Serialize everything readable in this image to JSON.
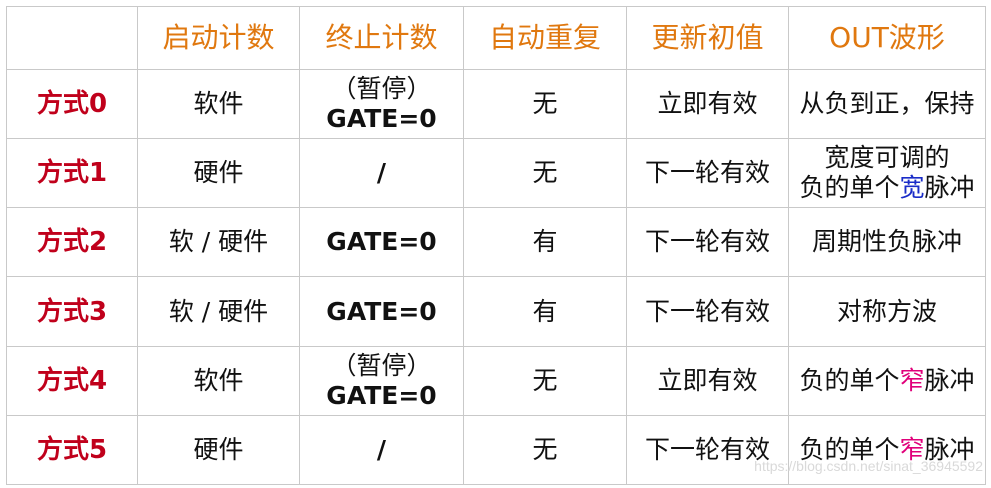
{
  "headers": [
    "",
    "启动计数",
    "终止计数",
    "自动重复",
    "更新初值",
    "OUT波形"
  ],
  "rows": [
    {
      "mode": "方式0",
      "start": "软件",
      "stop_top": "（暂停）",
      "stop_bottom": "GATE=0",
      "repeat": "无",
      "update": "立即有效",
      "out_pre": "从负到正，保持",
      "out_hl": "",
      "out_post": ""
    },
    {
      "mode": "方式1",
      "start": "硬件",
      "stop_top": "",
      "stop_bottom": "/",
      "repeat": "无",
      "update": "下一轮有效",
      "out_line1": "宽度可调的",
      "out_pre": "负的单个",
      "out_hl": "宽",
      "out_post": "脉冲",
      "out_hl_color": "#1a2cc8"
    },
    {
      "mode": "方式2",
      "start": "软 / 硬件",
      "stop_top": "",
      "stop_bottom": "GATE=0",
      "repeat": "有",
      "update": "下一轮有效",
      "out_pre": "周期性负脉冲",
      "out_hl": "",
      "out_post": ""
    },
    {
      "mode": "方式3",
      "start": "软 / 硬件",
      "stop_top": "",
      "stop_bottom": "GATE=0",
      "repeat": "有",
      "update": "下一轮有效",
      "out_pre": "对称方波",
      "out_hl": "",
      "out_post": ""
    },
    {
      "mode": "方式4",
      "start": "软件",
      "stop_top": "（暂停）",
      "stop_bottom": "GATE=0",
      "repeat": "无",
      "update": "立即有效",
      "out_pre": "负的单个",
      "out_hl": "窄",
      "out_post": "脉冲",
      "out_hl_color": "#e0007a"
    },
    {
      "mode": "方式5",
      "start": "硬件",
      "stop_top": "",
      "stop_bottom": "/",
      "repeat": "无",
      "update": "下一轮有效",
      "out_pre": "负的单个",
      "out_hl": "窄",
      "out_post": "脉冲",
      "out_hl_color": "#e0007a"
    }
  ],
  "watermark": "https://blog.csdn.net/sinat_36945592",
  "colors": {
    "header_text": "#e0780f",
    "mode_text": "#c0001b",
    "border": "#c9c9c9"
  }
}
